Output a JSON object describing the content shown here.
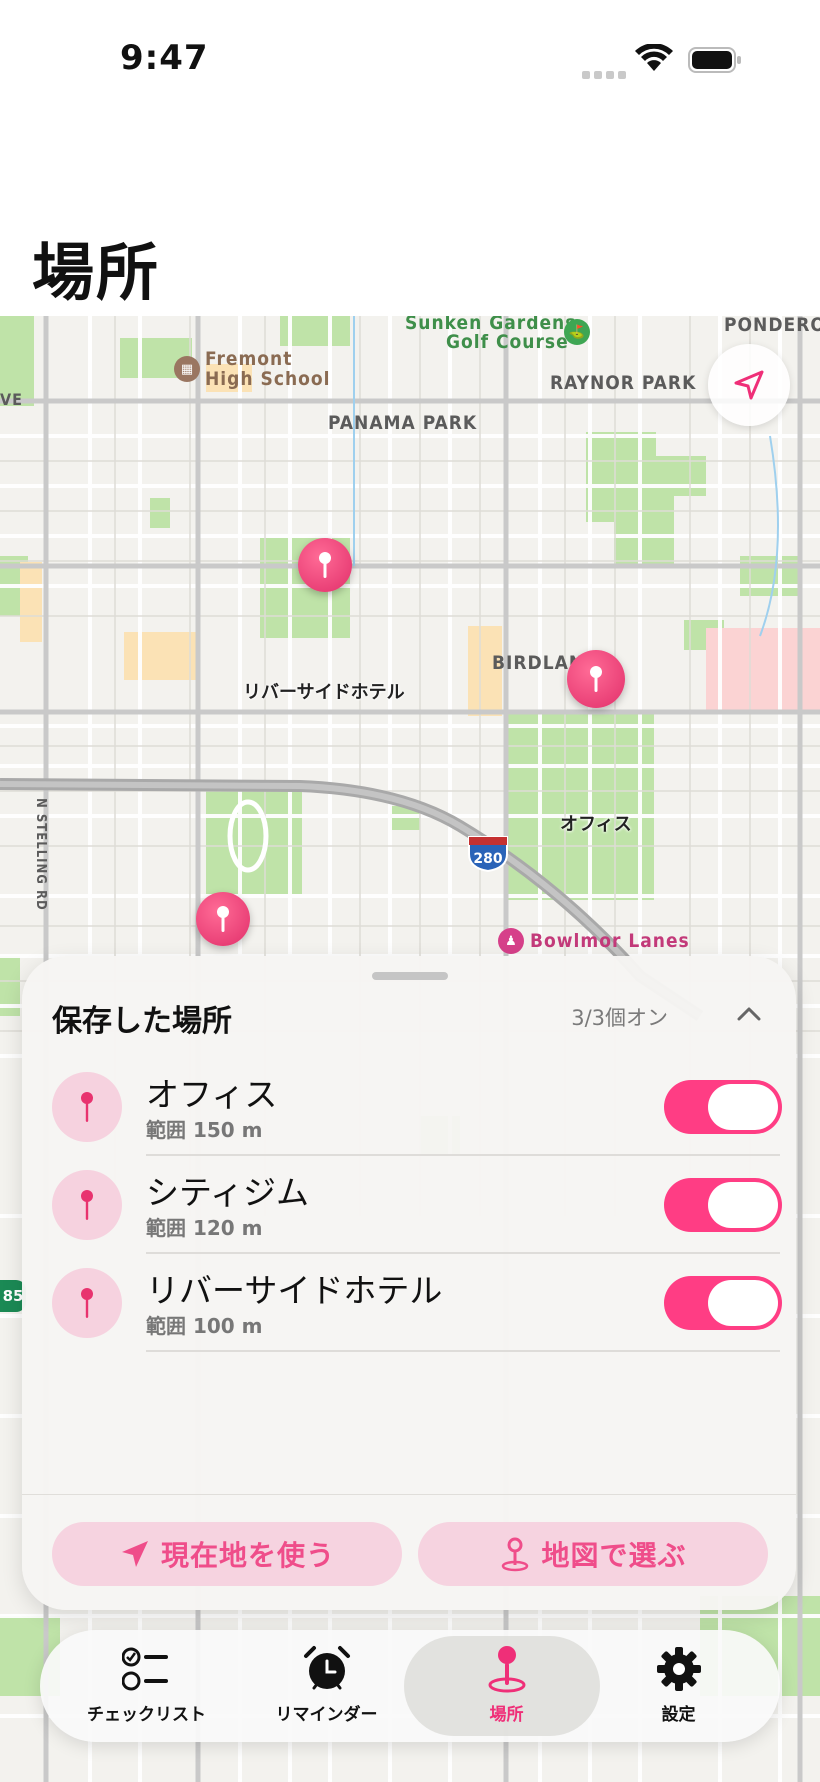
{
  "status_bar": {
    "time": "9:47"
  },
  "page": {
    "title": "場所"
  },
  "map": {
    "labels": {
      "sunken": "Sunken Gardens",
      "golf": "Golf Course",
      "ponderosa": "PONDEROS",
      "fremont1": "Fremont",
      "fremont2": "High School",
      "ve": "VE",
      "raynor": "RAYNOR PARK",
      "panama": "PANAMA PARK",
      "birdland": "BIRDLAND",
      "stelling": "N STELLING RD",
      "bowlmor": "Bowlmor Lanes",
      "hwy280": "280",
      "hwy85": "85"
    },
    "pins": [
      {
        "label": "リバーサイドホテル"
      },
      {
        "label": "オフィス"
      },
      {
        "label": ""
      }
    ]
  },
  "sheet": {
    "title": "保存した場所",
    "count": "3/3個オン",
    "locations": [
      {
        "name": "オフィス",
        "range": "範囲 150 m",
        "enabled": true
      },
      {
        "name": "シティジム",
        "range": "範囲 120 m",
        "enabled": true
      },
      {
        "name": "リバーサイドホテル",
        "range": "範囲 100 m",
        "enabled": true
      }
    ],
    "actions": {
      "use_current": "現在地を使う",
      "choose_on_map": "地図で選ぶ"
    }
  },
  "tabbar": {
    "tabs": [
      {
        "label": "チェックリスト",
        "icon": "checklist-icon"
      },
      {
        "label": "リマインダー",
        "icon": "alarm-clock-icon"
      },
      {
        "label": "場所",
        "icon": "location-pin-icon",
        "active": true
      },
      {
        "label": "設定",
        "icon": "gear-icon"
      }
    ]
  },
  "colors": {
    "accent": "#ef2f78",
    "toggle_on": "#ff3d84",
    "pin": "#e12f6a",
    "pale_pink": "#f6d3e0"
  }
}
